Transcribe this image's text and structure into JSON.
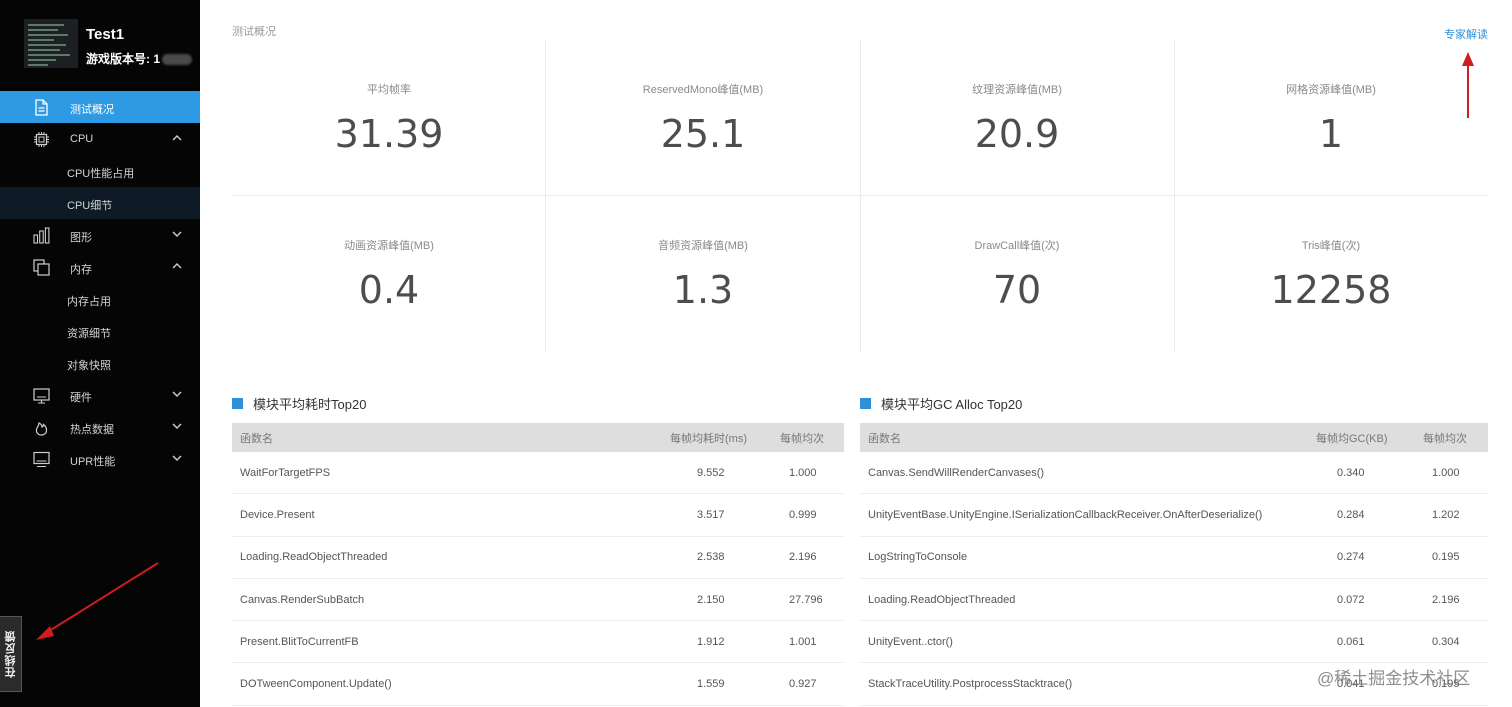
{
  "project": {
    "title": "Test1",
    "version_label": "游戏版本号: 1"
  },
  "nav": [
    {
      "label": "测试概况",
      "icon": "document-icon",
      "state": "active"
    },
    {
      "label": "CPU",
      "icon": "cpu-chip-icon",
      "chevron": "up"
    },
    {
      "label": "CPU性能占用",
      "sub": true
    },
    {
      "label": "CPU细节",
      "sub": true,
      "state": "sub-active"
    },
    {
      "label": "图形",
      "icon": "bar-chart-icon",
      "chevron": "down"
    },
    {
      "label": "内存",
      "icon": "copy-icon",
      "chevron": "up"
    },
    {
      "label": "内存占用",
      "sub": true
    },
    {
      "label": "资源细节",
      "sub": true
    },
    {
      "label": "对象快照",
      "sub": true
    },
    {
      "label": "硬件",
      "icon": "monitor-icon",
      "chevron": "down"
    },
    {
      "label": "热点数据",
      "icon": "flame-icon",
      "chevron": "down"
    },
    {
      "label": "UPR性能",
      "icon": "display-icon",
      "chevron": "down"
    }
  ],
  "feedback_label": "在线反馈",
  "overview": {
    "title": "测试概况",
    "expert_link": "专家解读",
    "stats": [
      {
        "label": "平均帧率",
        "value": "31.39"
      },
      {
        "label": "ReservedMono峰值(MB)",
        "value": "25.1"
      },
      {
        "label": "纹理资源峰值(MB)",
        "value": "20.9"
      },
      {
        "label": "网格资源峰值(MB)",
        "value": "1"
      },
      {
        "label": "动画资源峰值(MB)",
        "value": "0.4"
      },
      {
        "label": "音频资源峰值(MB)",
        "value": "1.3"
      },
      {
        "label": "DrawCall峰值(次)",
        "value": "70"
      },
      {
        "label": "Tris峰值(次)",
        "value": "12258"
      }
    ]
  },
  "table_time": {
    "title": "模块平均耗时Top20",
    "headers": [
      "函数名",
      "每帧均耗时(ms)",
      "每帧均次"
    ],
    "rows": [
      [
        "WaitForTargetFPS",
        "9.552",
        "1.000"
      ],
      [
        "Device.Present",
        "3.517",
        "0.999"
      ],
      [
        "Loading.ReadObjectThreaded",
        "2.538",
        "2.196"
      ],
      [
        "Canvas.RenderSubBatch",
        "2.150",
        "27.796"
      ],
      [
        "Present.BlitToCurrentFB",
        "1.912",
        "1.001"
      ],
      [
        "DOTweenComponent.Update()",
        "1.559",
        "0.927"
      ]
    ]
  },
  "table_gc": {
    "title": "模块平均GC Alloc Top20",
    "headers": [
      "函数名",
      "每帧均GC(KB)",
      "每帧均次"
    ],
    "rows": [
      [
        "Canvas.SendWillRenderCanvases()",
        "0.340",
        "1.000"
      ],
      [
        "UnityEventBase.UnityEngine.ISerializationCallbackReceiver.OnAfterDeserialize()",
        "0.284",
        "1.202"
      ],
      [
        "LogStringToConsole",
        "0.274",
        "0.195"
      ],
      [
        "Loading.ReadObjectThreaded",
        "0.072",
        "2.196"
      ],
      [
        "UnityEvent..ctor()",
        "0.061",
        "0.304"
      ],
      [
        "StackTraceUtility.PostprocessStacktrace()",
        "0.041",
        "0.195"
      ]
    ]
  },
  "watermark": "@稀土掘金技术社区",
  "colors": {
    "sidebar_bg": "#050505",
    "active": "#2f9ae4",
    "link": "#2f8fd8",
    "arrow": "#d01c1c",
    "table_header": "#dedede"
  }
}
